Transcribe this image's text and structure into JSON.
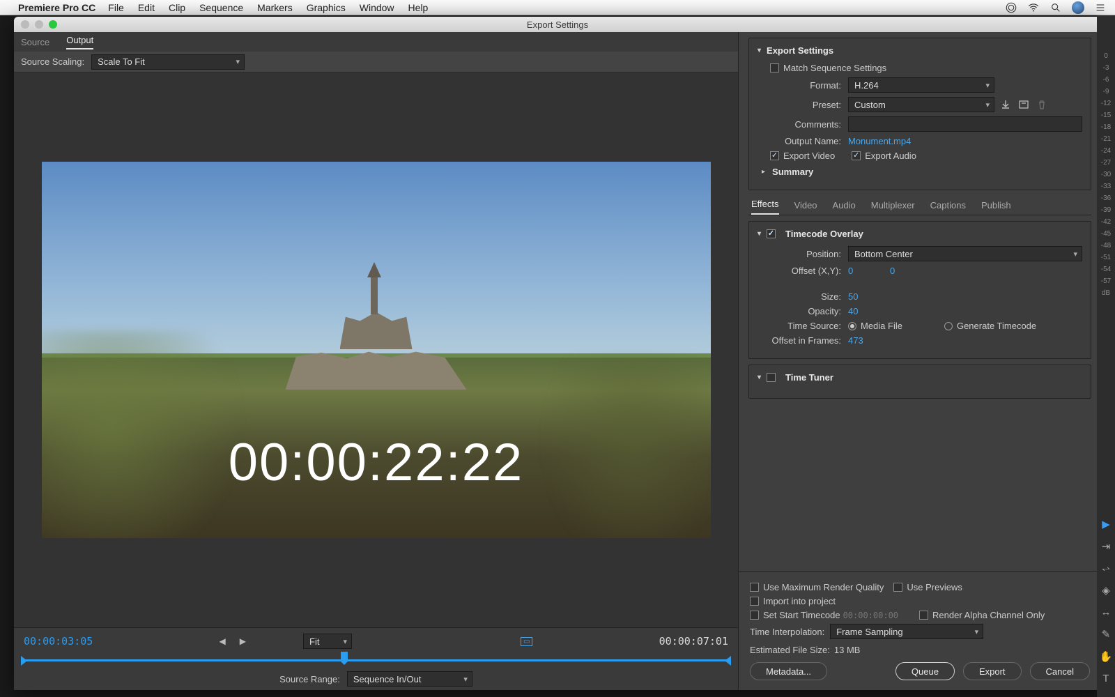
{
  "menubar": {
    "app": "Premiere Pro CC",
    "items": [
      "File",
      "Edit",
      "Clip",
      "Sequence",
      "Markers",
      "Graphics",
      "Window",
      "Help"
    ]
  },
  "window": {
    "title": "Export Settings"
  },
  "left": {
    "tabs": {
      "source": "Source",
      "output": "Output",
      "active": "Output"
    },
    "scaling_label": "Source Scaling:",
    "scaling_value": "Scale To Fit",
    "timecode_overlay_text": "00:00:22:22",
    "transport": {
      "in_tc": "00:00:03:05",
      "out_tc": "00:00:07:01",
      "fit_label": "Fit",
      "range_label": "Source Range:",
      "range_value": "Sequence In/Out"
    }
  },
  "export": {
    "heading": "Export Settings",
    "match_seq": "Match Sequence Settings",
    "format_label": "Format:",
    "format_value": "H.264",
    "preset_label": "Preset:",
    "preset_value": "Custom",
    "comments_label": "Comments:",
    "outname_label": "Output Name:",
    "outname_value": "Monument.mp4",
    "export_video": "Export Video",
    "export_audio": "Export Audio",
    "summary": "Summary"
  },
  "inner_tabs": [
    "Effects",
    "Video",
    "Audio",
    "Multiplexer",
    "Captions",
    "Publish"
  ],
  "timecode": {
    "heading": "Timecode Overlay",
    "position_label": "Position:",
    "position_value": "Bottom Center",
    "offset_label": "Offset (X,Y):",
    "offset_x": "0",
    "offset_y": "0",
    "size_label": "Size:",
    "size_value": "50",
    "opacity_label": "Opacity:",
    "opacity_value": "40",
    "timesource_label": "Time Source:",
    "media_file": "Media File",
    "gen_tc": "Generate Timecode",
    "offset_frames_label": "Offset in Frames:",
    "offset_frames_value": "473"
  },
  "timetuner": {
    "heading": "Time Tuner"
  },
  "footer": {
    "max_quality": "Use Maximum Render Quality",
    "use_previews": "Use Previews",
    "import_project": "Import into project",
    "set_start_tc": "Set Start Timecode",
    "start_tc_value": "00:00:00:00",
    "render_alpha": "Render Alpha Channel Only",
    "time_interp_label": "Time Interpolation:",
    "time_interp_value": "Frame Sampling",
    "est_label": "Estimated File Size:",
    "est_value": "13 MB",
    "metadata": "Metadata...",
    "queue": "Queue",
    "export": "Export",
    "cancel": "Cancel"
  },
  "meter_labels": [
    "0",
    "-3",
    "-6",
    "-9",
    "-12",
    "-15",
    "-18",
    "-21",
    "-24",
    "-27",
    "-30",
    "-33",
    "-36",
    "-39",
    "-42",
    "-45",
    "-48",
    "-51",
    "-54",
    "-57",
    "dB"
  ]
}
